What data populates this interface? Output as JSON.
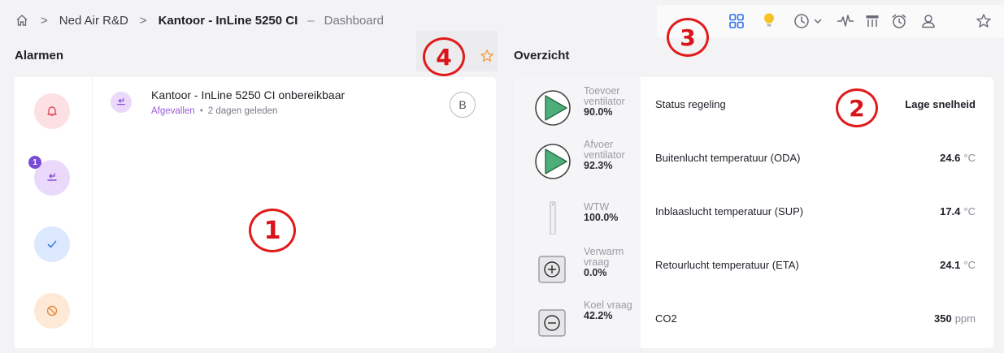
{
  "breadcrumb": {
    "items": [
      "Ned Air R&D",
      "Kantoor - InLine 5250 CI"
    ],
    "separator": ">",
    "dash": "–",
    "view": "Dashboard"
  },
  "toolbar": {
    "icons": [
      "dashboard-grid-icon",
      "lightbulb-icon",
      "history-clock-icon",
      "chevron-down-icon",
      "pulse-icon",
      "table-icon",
      "alarm-clock-icon",
      "user-icon",
      "star-icon"
    ],
    "active_color": "#2f6fea",
    "bulb_color": "#f6c325"
  },
  "markers": [
    "1",
    "2",
    "3",
    "4"
  ],
  "alarms": {
    "heading": "Alarmen",
    "filters": [
      {
        "name": "alarm-bell-filter",
        "color": "#fde0e3",
        "icon_color": "#e2485b"
      },
      {
        "name": "dropped-filter",
        "color": "#ead9fb",
        "icon_color": "#8a4fd8",
        "badge": "1"
      },
      {
        "name": "acknowledged-filter",
        "color": "#dce8fd",
        "icon_color": "#3d7ee8"
      },
      {
        "name": "blocked-filter",
        "color": "#fde9d6",
        "icon_color": "#e38a3d"
      }
    ],
    "items": [
      {
        "title": "Kantoor - InLine 5250 CI onbereikbaar",
        "status": "Afgevallen",
        "separator": "•",
        "time": "2 dagen geleden",
        "ack_label": "B"
      }
    ]
  },
  "overview": {
    "heading": "Overzicht",
    "components": [
      {
        "label": "Toevoer ventilator",
        "value": "90.0%",
        "icon": "fan-play-icon"
      },
      {
        "label": "Afvoer ventilator",
        "value": "92.3%",
        "icon": "fan-play-icon"
      },
      {
        "label": "WTW",
        "value": "100.0%",
        "icon": "heat-exchanger-icon"
      },
      {
        "label": "Verwarm vraag",
        "value": "0.0%",
        "icon": "plus-icon"
      },
      {
        "label": "Koel vraag",
        "value": "42.2%",
        "icon": "minus-icon"
      }
    ],
    "rows": [
      {
        "name": "Status regeling",
        "value": "Lage snelheid",
        "unit": ""
      },
      {
        "name": "Buitenlucht temperatuur (ODA)",
        "value": "24.6",
        "unit": "°C"
      },
      {
        "name": "Inblaaslucht temperatuur (SUP)",
        "value": "17.4",
        "unit": "°C"
      },
      {
        "name": "Retourlucht temperatuur (ETA)",
        "value": "24.1",
        "unit": "°C"
      },
      {
        "name": "CO2",
        "value": "350",
        "unit": "ppm"
      }
    ]
  }
}
